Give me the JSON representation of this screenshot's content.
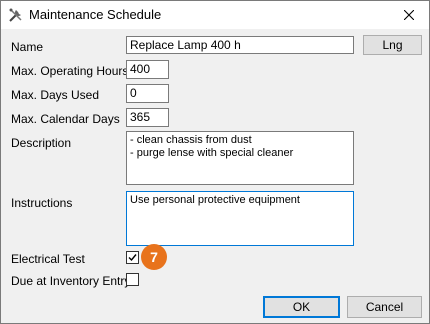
{
  "window": {
    "title": "Maintenance Schedule",
    "app_icon": "tools-icon",
    "close_icon": "close-icon"
  },
  "form": {
    "name_label": "Name",
    "name_value": "Replace Lamp 400 h",
    "lng_button": "Lng",
    "max_hours_label": "Max. Operating Hours",
    "max_hours_value": "400",
    "max_days_used_label": "Max. Days Used",
    "max_days_used_value": "0",
    "max_calendar_days_label": "Max. Calendar Days",
    "max_calendar_days_value": "365",
    "description_label": "Description",
    "description_lines": [
      "- clean chassis from dust",
      "- purge lense with special cleaner"
    ],
    "instructions_label": "Instructions",
    "instructions_value": "Use personal protective equipment",
    "electrical_test_label": "Electrical Test",
    "electrical_test_checked": true,
    "due_inventory_label": "Due at Inventory Entry",
    "due_inventory_checked": false
  },
  "badge": {
    "number": "7",
    "color": "#e8731c"
  },
  "buttons": {
    "ok": "OK",
    "cancel": "Cancel"
  },
  "colors": {
    "focus_border": "#0078d7"
  }
}
